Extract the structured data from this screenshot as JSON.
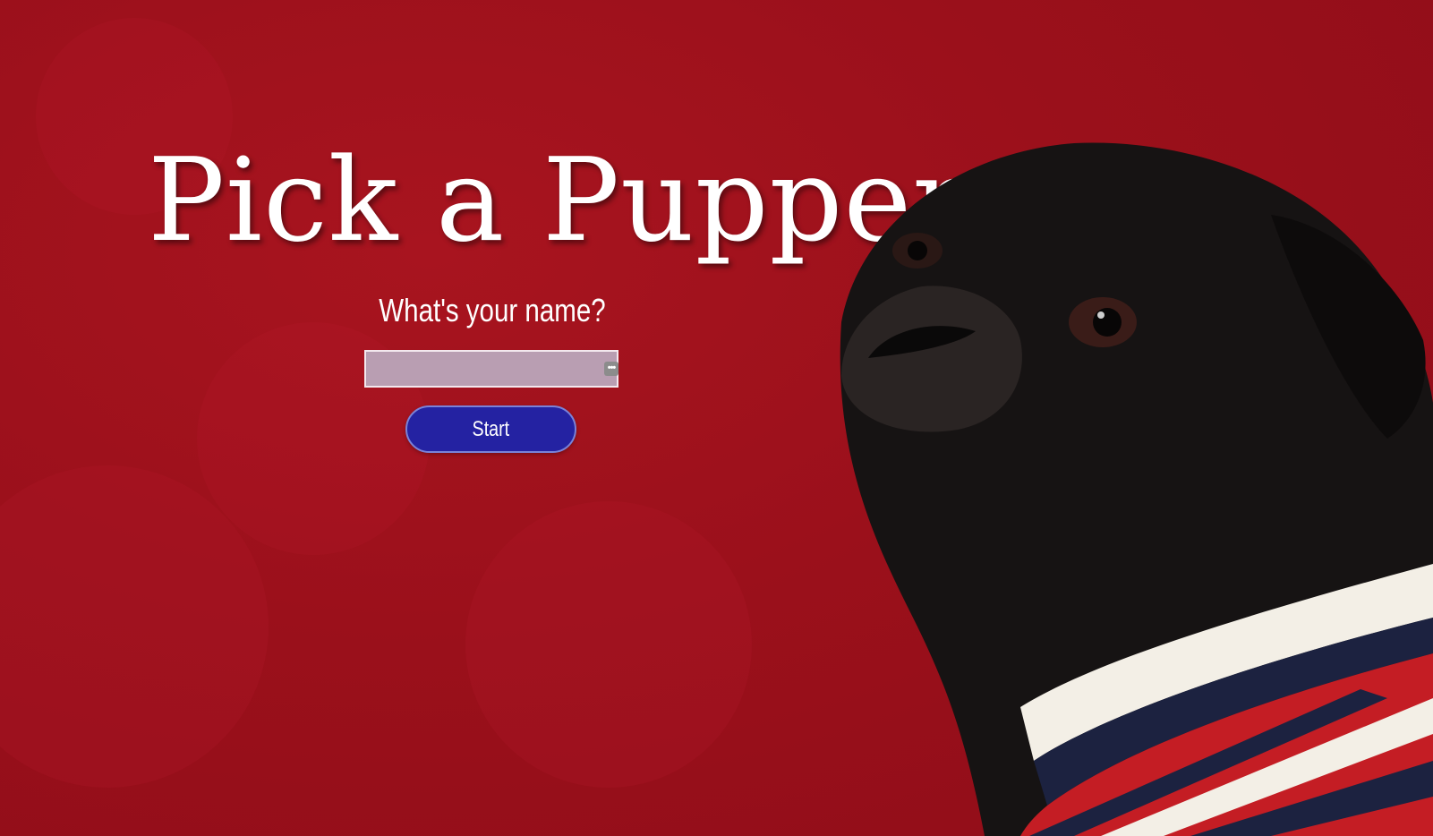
{
  "page": {
    "title": "Pick a Pupper",
    "prompt": "What's your name?",
    "name_input": {
      "value": "",
      "placeholder": ""
    },
    "start_button_label": "Start",
    "autofill_icon": "ellipsis-icon"
  },
  "colors": {
    "background": "#9b101b",
    "title_text": "#ffffff",
    "input_background": "#b99eb2",
    "button_background": "#2422a2",
    "button_border": "#7a82d8"
  },
  "image": {
    "subject": "pug-photo"
  }
}
